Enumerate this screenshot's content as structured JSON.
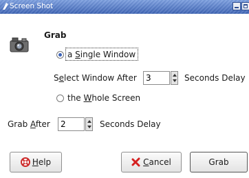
{
  "window": {
    "title": "Screen Shot"
  },
  "section": {
    "title": "Grab"
  },
  "options": {
    "single_window": {
      "prefix": "a ",
      "mnemonic": "S",
      "rest": "ingle Window",
      "selected": true
    },
    "whole_screen": {
      "prefix": "the ",
      "mnemonic": "W",
      "rest": "hole Screen",
      "selected": false
    }
  },
  "select_delay": {
    "label_prefix": "S",
    "label_mnemonic": "e",
    "label_rest": "lect Window After",
    "value": "3",
    "unit": "Seconds Delay"
  },
  "grab_delay": {
    "label_prefix": "Grab ",
    "label_mnemonic": "A",
    "label_rest": "fter",
    "value": "2",
    "unit": "Seconds Delay"
  },
  "buttons": {
    "help": {
      "mnemonic": "H",
      "rest": "elp"
    },
    "cancel": {
      "mnemonic": "C",
      "rest": "ancel"
    },
    "grab": {
      "label": "Grab"
    }
  },
  "icons": {
    "title": "window-menu-icon",
    "camera": "camera-icon",
    "help": "help-lifebuoy-icon",
    "cancel": "cancel-x-icon"
  },
  "colors": {
    "titlebar": "#4d74c4",
    "radio_selected": "#3b62b8",
    "cancel_icon": "#d52020",
    "help_icon": "#cc2a2a"
  }
}
